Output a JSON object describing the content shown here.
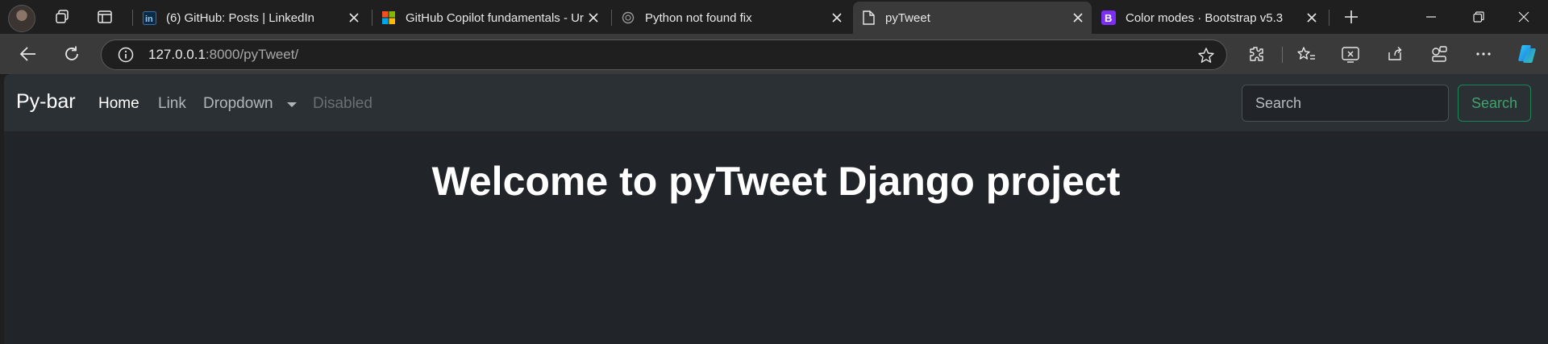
{
  "browser": {
    "tabs": [
      {
        "title": "(6) GitHub: Posts | LinkedIn",
        "favicon": "linkedin-icon",
        "active": false
      },
      {
        "title": "GitHub Copilot fundamentals - Ur",
        "favicon": "microsoft-icon",
        "active": false
      },
      {
        "title": "Python not found fix",
        "favicon": "chatgpt-icon",
        "active": false
      },
      {
        "title": "pyTweet",
        "favicon": "page-icon",
        "active": true
      },
      {
        "title": "Color modes · Bootstrap v5.3",
        "favicon": "bootstrap-icon",
        "active": false
      }
    ],
    "address": {
      "host": "127.0.0.1",
      "path": ":8000/pyTweet/"
    }
  },
  "navbar": {
    "brand": "Py-bar",
    "links": [
      {
        "label": "Home",
        "state": "active"
      },
      {
        "label": "Link",
        "state": "normal"
      },
      {
        "label": "Dropdown",
        "state": "dropdown"
      },
      {
        "label": "Disabled",
        "state": "disabled"
      }
    ],
    "search": {
      "placeholder": "Search",
      "button_label": "Search"
    }
  },
  "main": {
    "heading": "Welcome to pyTweet Django project"
  },
  "colors": {
    "page_bg": "#212529",
    "navbar_bg": "#2b3035",
    "search_button": "#198754",
    "bootstrap_purple": "#7a2ff2"
  }
}
